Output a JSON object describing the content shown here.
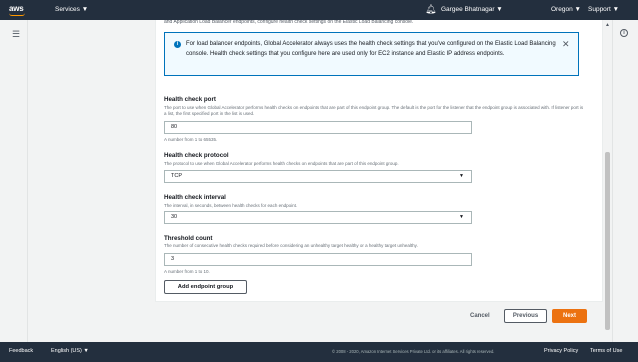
{
  "topbar": {
    "logo_text": "aws",
    "services_label": "Services ▼",
    "user_label": "Gargee Bhatnagar ▼",
    "region_label": "Oregon ▼",
    "support_label": "Support ▼"
  },
  "content": {
    "cut_text": "and Application Load Balancer endpoints, configure health check settings on the Elastic Load Balancing console.",
    "alert_text": "For load balancer endpoints, Global Accelerator always uses the health check settings that you've configured on the Elastic Load Balancing console. Health check settings that you configure here are used only for EC2 instance and Elastic IP address endpoints.",
    "port": {
      "label": "Health check port",
      "description": "The port to use when Global Accelerator performs health checks on endpoints that are part of this endpoint group. The default is the port for the listener that the endpoint group is associated with. If listener port is a list, the first specified port in the list is used.",
      "value": "80",
      "hint": "A number from 1 to 65535."
    },
    "protocol": {
      "label": "Health check protocol",
      "description": "The protocol to use when Global Accelerator performs health checks on endpoints that are part of this endpoint group.",
      "value": "TCP"
    },
    "interval": {
      "label": "Health check interval",
      "description": "The interval, in seconds, between health checks for each endpoint.",
      "value": "30"
    },
    "threshold": {
      "label": "Threshold count",
      "description": "The number of consecutive health checks required before considering an unhealthy target healthy or a healthy target unhealthy.",
      "value": "3",
      "hint": "A number from 1 to 10."
    },
    "add_endpoint_group_label": "Add endpoint group"
  },
  "actions": {
    "cancel_label": "Cancel",
    "previous_label": "Previous",
    "next_label": "Next"
  },
  "footer": {
    "feedback_label": "Feedback",
    "language_label": "English (US) ▼",
    "copyright": "© 2008 - 2020, Amazon Internet Services Private Ltd. or its affiliates. All rights reserved.",
    "privacy_label": "Privacy Policy",
    "terms_label": "Terms of Use"
  },
  "colors": {
    "navbar": "#232f3e",
    "accent_orange": "#ec7211",
    "info_blue": "#0073bb"
  }
}
